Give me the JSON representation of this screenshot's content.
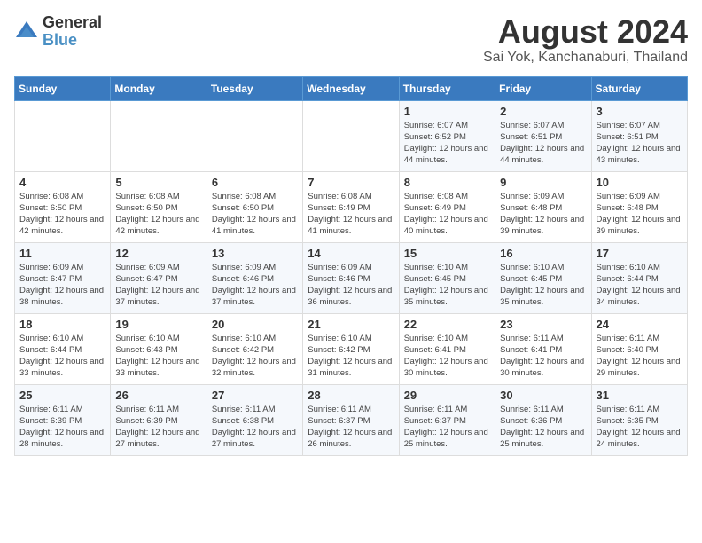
{
  "header": {
    "logo_general": "General",
    "logo_blue": "Blue",
    "month_year": "August 2024",
    "location": "Sai Yok, Kanchanaburi, Thailand"
  },
  "weekdays": [
    "Sunday",
    "Monday",
    "Tuesday",
    "Wednesday",
    "Thursday",
    "Friday",
    "Saturday"
  ],
  "weeks": [
    [
      {
        "day": "",
        "sunrise": "",
        "sunset": "",
        "daylight": ""
      },
      {
        "day": "",
        "sunrise": "",
        "sunset": "",
        "daylight": ""
      },
      {
        "day": "",
        "sunrise": "",
        "sunset": "",
        "daylight": ""
      },
      {
        "day": "",
        "sunrise": "",
        "sunset": "",
        "daylight": ""
      },
      {
        "day": "1",
        "sunrise": "Sunrise: 6:07 AM",
        "sunset": "Sunset: 6:52 PM",
        "daylight": "Daylight: 12 hours and 44 minutes."
      },
      {
        "day": "2",
        "sunrise": "Sunrise: 6:07 AM",
        "sunset": "Sunset: 6:51 PM",
        "daylight": "Daylight: 12 hours and 44 minutes."
      },
      {
        "day": "3",
        "sunrise": "Sunrise: 6:07 AM",
        "sunset": "Sunset: 6:51 PM",
        "daylight": "Daylight: 12 hours and 43 minutes."
      }
    ],
    [
      {
        "day": "4",
        "sunrise": "Sunrise: 6:08 AM",
        "sunset": "Sunset: 6:50 PM",
        "daylight": "Daylight: 12 hours and 42 minutes."
      },
      {
        "day": "5",
        "sunrise": "Sunrise: 6:08 AM",
        "sunset": "Sunset: 6:50 PM",
        "daylight": "Daylight: 12 hours and 42 minutes."
      },
      {
        "day": "6",
        "sunrise": "Sunrise: 6:08 AM",
        "sunset": "Sunset: 6:50 PM",
        "daylight": "Daylight: 12 hours and 41 minutes."
      },
      {
        "day": "7",
        "sunrise": "Sunrise: 6:08 AM",
        "sunset": "Sunset: 6:49 PM",
        "daylight": "Daylight: 12 hours and 41 minutes."
      },
      {
        "day": "8",
        "sunrise": "Sunrise: 6:08 AM",
        "sunset": "Sunset: 6:49 PM",
        "daylight": "Daylight: 12 hours and 40 minutes."
      },
      {
        "day": "9",
        "sunrise": "Sunrise: 6:09 AM",
        "sunset": "Sunset: 6:48 PM",
        "daylight": "Daylight: 12 hours and 39 minutes."
      },
      {
        "day": "10",
        "sunrise": "Sunrise: 6:09 AM",
        "sunset": "Sunset: 6:48 PM",
        "daylight": "Daylight: 12 hours and 39 minutes."
      }
    ],
    [
      {
        "day": "11",
        "sunrise": "Sunrise: 6:09 AM",
        "sunset": "Sunset: 6:47 PM",
        "daylight": "Daylight: 12 hours and 38 minutes."
      },
      {
        "day": "12",
        "sunrise": "Sunrise: 6:09 AM",
        "sunset": "Sunset: 6:47 PM",
        "daylight": "Daylight: 12 hours and 37 minutes."
      },
      {
        "day": "13",
        "sunrise": "Sunrise: 6:09 AM",
        "sunset": "Sunset: 6:46 PM",
        "daylight": "Daylight: 12 hours and 37 minutes."
      },
      {
        "day": "14",
        "sunrise": "Sunrise: 6:09 AM",
        "sunset": "Sunset: 6:46 PM",
        "daylight": "Daylight: 12 hours and 36 minutes."
      },
      {
        "day": "15",
        "sunrise": "Sunrise: 6:10 AM",
        "sunset": "Sunset: 6:45 PM",
        "daylight": "Daylight: 12 hours and 35 minutes."
      },
      {
        "day": "16",
        "sunrise": "Sunrise: 6:10 AM",
        "sunset": "Sunset: 6:45 PM",
        "daylight": "Daylight: 12 hours and 35 minutes."
      },
      {
        "day": "17",
        "sunrise": "Sunrise: 6:10 AM",
        "sunset": "Sunset: 6:44 PM",
        "daylight": "Daylight: 12 hours and 34 minutes."
      }
    ],
    [
      {
        "day": "18",
        "sunrise": "Sunrise: 6:10 AM",
        "sunset": "Sunset: 6:44 PM",
        "daylight": "Daylight: 12 hours and 33 minutes."
      },
      {
        "day": "19",
        "sunrise": "Sunrise: 6:10 AM",
        "sunset": "Sunset: 6:43 PM",
        "daylight": "Daylight: 12 hours and 33 minutes."
      },
      {
        "day": "20",
        "sunrise": "Sunrise: 6:10 AM",
        "sunset": "Sunset: 6:42 PM",
        "daylight": "Daylight: 12 hours and 32 minutes."
      },
      {
        "day": "21",
        "sunrise": "Sunrise: 6:10 AM",
        "sunset": "Sunset: 6:42 PM",
        "daylight": "Daylight: 12 hours and 31 minutes."
      },
      {
        "day": "22",
        "sunrise": "Sunrise: 6:10 AM",
        "sunset": "Sunset: 6:41 PM",
        "daylight": "Daylight: 12 hours and 30 minutes."
      },
      {
        "day": "23",
        "sunrise": "Sunrise: 6:11 AM",
        "sunset": "Sunset: 6:41 PM",
        "daylight": "Daylight: 12 hours and 30 minutes."
      },
      {
        "day": "24",
        "sunrise": "Sunrise: 6:11 AM",
        "sunset": "Sunset: 6:40 PM",
        "daylight": "Daylight: 12 hours and 29 minutes."
      }
    ],
    [
      {
        "day": "25",
        "sunrise": "Sunrise: 6:11 AM",
        "sunset": "Sunset: 6:39 PM",
        "daylight": "Daylight: 12 hours and 28 minutes."
      },
      {
        "day": "26",
        "sunrise": "Sunrise: 6:11 AM",
        "sunset": "Sunset: 6:39 PM",
        "daylight": "Daylight: 12 hours and 27 minutes."
      },
      {
        "day": "27",
        "sunrise": "Sunrise: 6:11 AM",
        "sunset": "Sunset: 6:38 PM",
        "daylight": "Daylight: 12 hours and 27 minutes."
      },
      {
        "day": "28",
        "sunrise": "Sunrise: 6:11 AM",
        "sunset": "Sunset: 6:37 PM",
        "daylight": "Daylight: 12 hours and 26 minutes."
      },
      {
        "day": "29",
        "sunrise": "Sunrise: 6:11 AM",
        "sunset": "Sunset: 6:37 PM",
        "daylight": "Daylight: 12 hours and 25 minutes."
      },
      {
        "day": "30",
        "sunrise": "Sunrise: 6:11 AM",
        "sunset": "Sunset: 6:36 PM",
        "daylight": "Daylight: 12 hours and 25 minutes."
      },
      {
        "day": "31",
        "sunrise": "Sunrise: 6:11 AM",
        "sunset": "Sunset: 6:35 PM",
        "daylight": "Daylight: 12 hours and 24 minutes."
      }
    ]
  ]
}
